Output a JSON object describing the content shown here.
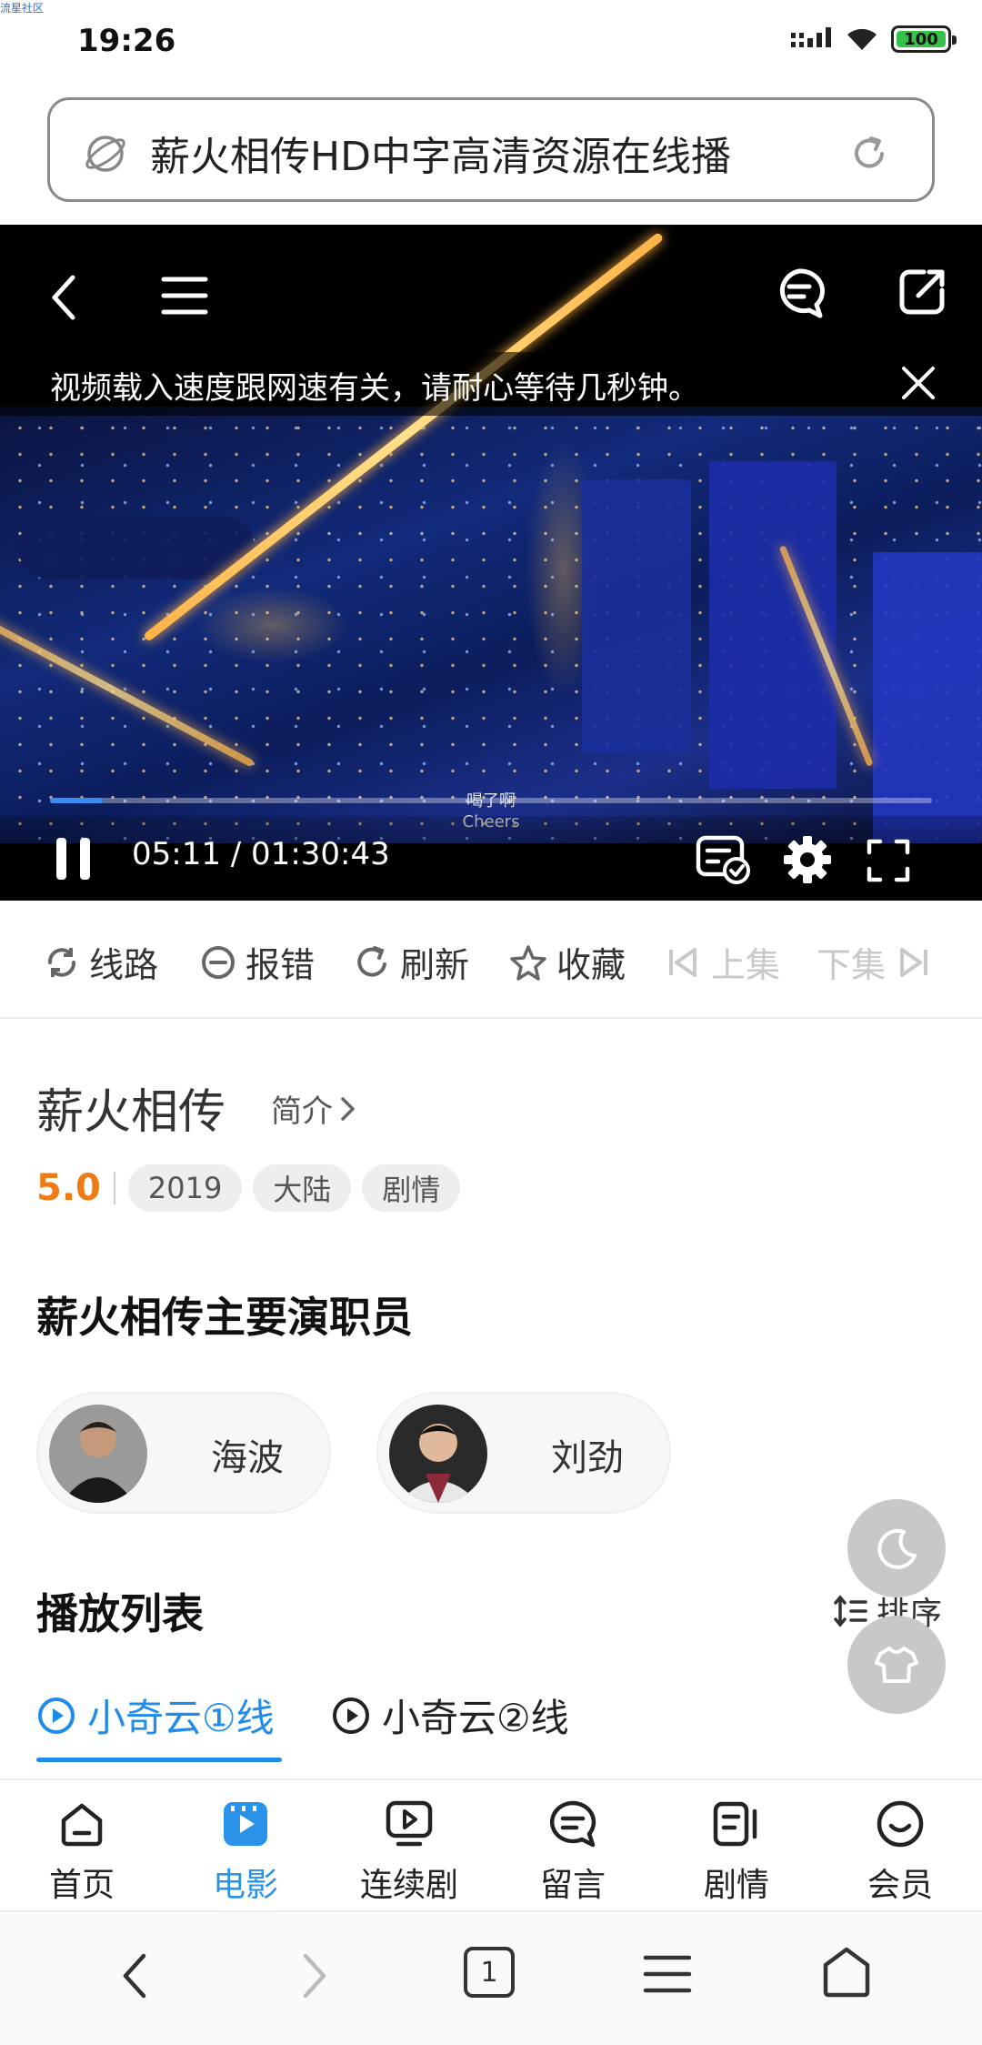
{
  "status_bar": {
    "watermark": "流星社区",
    "time": "19:26",
    "battery": "100"
  },
  "address_bar": {
    "text": "薪火相传HD中字高清资源在线播"
  },
  "player": {
    "notice": "视频载入速度跟网速有关，请耐心等待几秒钟。",
    "time": "05:11 / 01:30:43",
    "progress": 0.06,
    "subtitle_cn": "喝了啊",
    "subtitle_en": "Cheers"
  },
  "actions": {
    "route": "线路",
    "report": "报错",
    "refresh": "刷新",
    "collect": "收藏",
    "prev": "上集",
    "next": "下集"
  },
  "movie": {
    "title": "薪火相传",
    "intro": "简介",
    "score": "5.0",
    "tags": [
      "2019",
      "大陆",
      "剧情"
    ]
  },
  "cast": {
    "heading": "薪火相传主要演职员",
    "actors": [
      {
        "name": "海波"
      },
      {
        "name": "刘劲"
      }
    ]
  },
  "playlist": {
    "heading": "播放列表",
    "sort": "排序",
    "sources": [
      "小奇云①线",
      "小奇云②线"
    ]
  },
  "app_nav": [
    {
      "label": "首页",
      "icon": "home-icon"
    },
    {
      "label": "电影",
      "icon": "movie-icon"
    },
    {
      "label": "连续剧",
      "icon": "tv-series-icon"
    },
    {
      "label": "留言",
      "icon": "message-icon"
    },
    {
      "label": "剧情",
      "icon": "plot-icon"
    },
    {
      "label": "会员",
      "icon": "member-icon"
    }
  ],
  "browser_nav": {
    "tab_count": "1"
  },
  "colors": {
    "accent": "#1f8ceb",
    "score": "#f07b16"
  }
}
